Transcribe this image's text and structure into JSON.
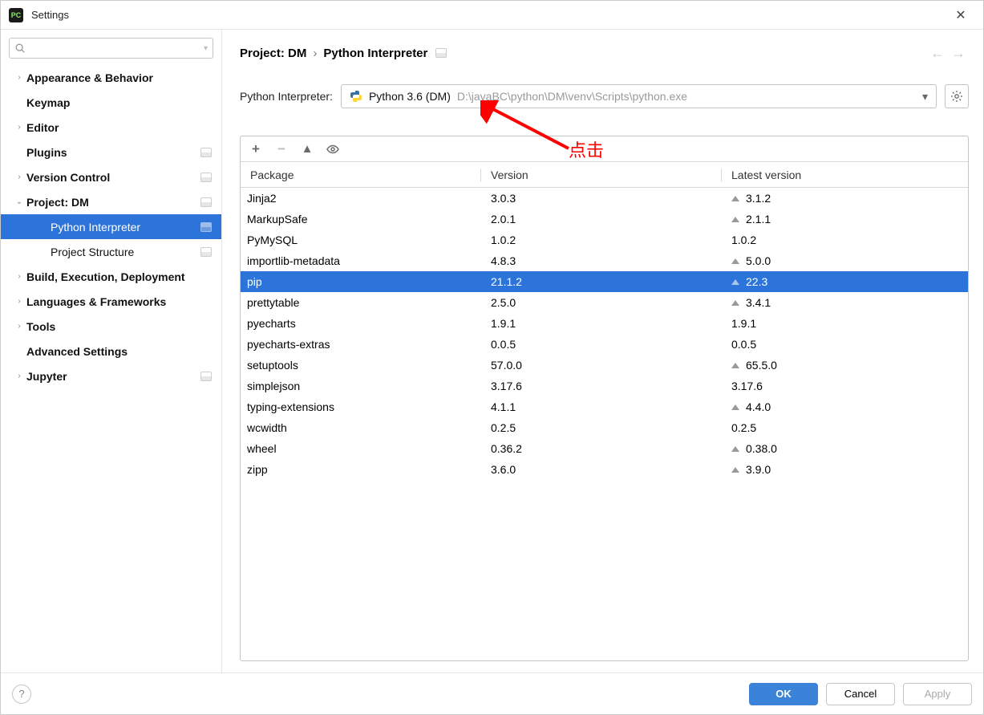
{
  "title": "Settings",
  "sidebar": {
    "items": [
      {
        "label": "Appearance & Behavior",
        "bold": true,
        "expandable": true
      },
      {
        "label": "Keymap",
        "bold": true
      },
      {
        "label": "Editor",
        "bold": true,
        "expandable": true
      },
      {
        "label": "Plugins",
        "bold": true,
        "badge": true
      },
      {
        "label": "Version Control",
        "bold": true,
        "expandable": true,
        "badge": true
      },
      {
        "label": "Project: DM",
        "bold": true,
        "expandable": true,
        "expanded": true,
        "badge": true
      },
      {
        "label": "Python Interpreter",
        "level": 2,
        "selected": true,
        "badge": true
      },
      {
        "label": "Project Structure",
        "level": 2,
        "badge": true
      },
      {
        "label": "Build, Execution, Deployment",
        "bold": true,
        "expandable": true
      },
      {
        "label": "Languages & Frameworks",
        "bold": true,
        "expandable": true
      },
      {
        "label": "Tools",
        "bold": true,
        "expandable": true
      },
      {
        "label": "Advanced Settings",
        "bold": true
      },
      {
        "label": "Jupyter",
        "bold": true,
        "expandable": true,
        "badge": true
      }
    ]
  },
  "breadcrumb": {
    "root": "Project: DM",
    "leaf": "Python Interpreter"
  },
  "interpreter": {
    "label": "Python Interpreter:",
    "selected_name": "Python 3.6 (DM)",
    "selected_path": "D:\\javaBC\\python\\DM\\venv\\Scripts\\python.exe"
  },
  "annotation": {
    "text": "点击"
  },
  "columns": {
    "c1": "Package",
    "c2": "Version",
    "c3": "Latest version"
  },
  "packages": [
    {
      "name": "Jinja2",
      "version": "3.0.3",
      "latest": "3.1.2",
      "upgrade": true
    },
    {
      "name": "MarkupSafe",
      "version": "2.0.1",
      "latest": "2.1.1",
      "upgrade": true
    },
    {
      "name": "PyMySQL",
      "version": "1.0.2",
      "latest": "1.0.2"
    },
    {
      "name": "importlib-metadata",
      "version": "4.8.3",
      "latest": "5.0.0",
      "upgrade": true
    },
    {
      "name": "pip",
      "version": "21.1.2",
      "latest": "22.3",
      "upgrade": true,
      "selected": true
    },
    {
      "name": "prettytable",
      "version": "2.5.0",
      "latest": "3.4.1",
      "upgrade": true
    },
    {
      "name": "pyecharts",
      "version": "1.9.1",
      "latest": "1.9.1"
    },
    {
      "name": "pyecharts-extras",
      "version": "0.0.5",
      "latest": "0.0.5"
    },
    {
      "name": "setuptools",
      "version": "57.0.0",
      "latest": "65.5.0",
      "upgrade": true
    },
    {
      "name": "simplejson",
      "version": "3.17.6",
      "latest": "3.17.6"
    },
    {
      "name": "typing-extensions",
      "version": "4.1.1",
      "latest": "4.4.0",
      "upgrade": true
    },
    {
      "name": "wcwidth",
      "version": "0.2.5",
      "latest": "0.2.5"
    },
    {
      "name": "wheel",
      "version": "0.36.2",
      "latest": "0.38.0",
      "upgrade": true
    },
    {
      "name": "zipp",
      "version": "3.6.0",
      "latest": "3.9.0",
      "upgrade": true
    }
  ],
  "buttons": {
    "ok": "OK",
    "cancel": "Cancel",
    "apply": "Apply"
  }
}
